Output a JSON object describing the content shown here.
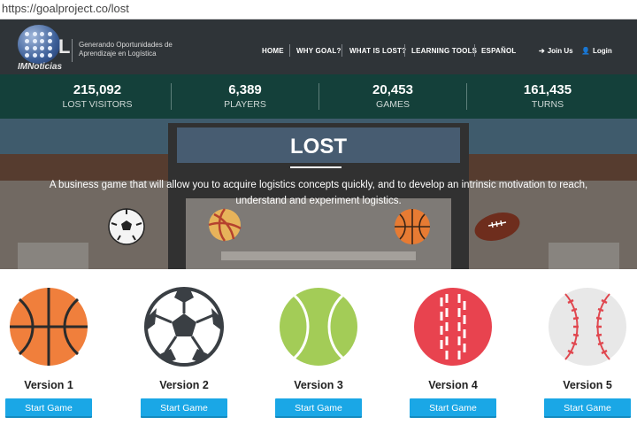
{
  "browser": {
    "url": "https://goalproject.co/lost"
  },
  "header": {
    "logo_text": "IMNoticias",
    "logo_letter": "L",
    "tagline": "Generando Oportunidades de Aprendizaje en Logística",
    "nav": [
      "HOME",
      "WHY GOAL?",
      "WHAT IS LOST?",
      "LEARNING TOOLS",
      "ESPAÑOL"
    ],
    "join_label": "Join Us",
    "login_label": "Login"
  },
  "stats": [
    {
      "value": "215,092",
      "label": "LOST VISITORS"
    },
    {
      "value": "6,389",
      "label": "PLAYERS"
    },
    {
      "value": "20,453",
      "label": "GAMES"
    },
    {
      "value": "161,435",
      "label": "TURNS"
    }
  ],
  "hero": {
    "title": "LOST",
    "description": "A business game that will allow you to acquire logistics concepts quickly, and to develop an intrinsic motivation to reach, understand and experiment logistics."
  },
  "versions": [
    {
      "label": "Version 1",
      "button": "Start Game",
      "icon": "basketball-icon",
      "color": "#f07f3c"
    },
    {
      "label": "Version 2",
      "button": "Start Game",
      "icon": "soccer-ball-icon",
      "color": "#3a3f44"
    },
    {
      "label": "Version 3",
      "button": "Start Game",
      "icon": "tennis-ball-icon",
      "color": "#a3cc57"
    },
    {
      "label": "Version 4",
      "button": "Start Game",
      "icon": "cricket-ball-icon",
      "color": "#e8434f"
    },
    {
      "label": "Version 5",
      "button": "Start Game",
      "icon": "baseball-icon",
      "color": "#e8e8e8"
    }
  ],
  "colors": {
    "nav_bg": "#2f3438",
    "stats_bg": "#14403a",
    "button": "#1aa7e6"
  }
}
